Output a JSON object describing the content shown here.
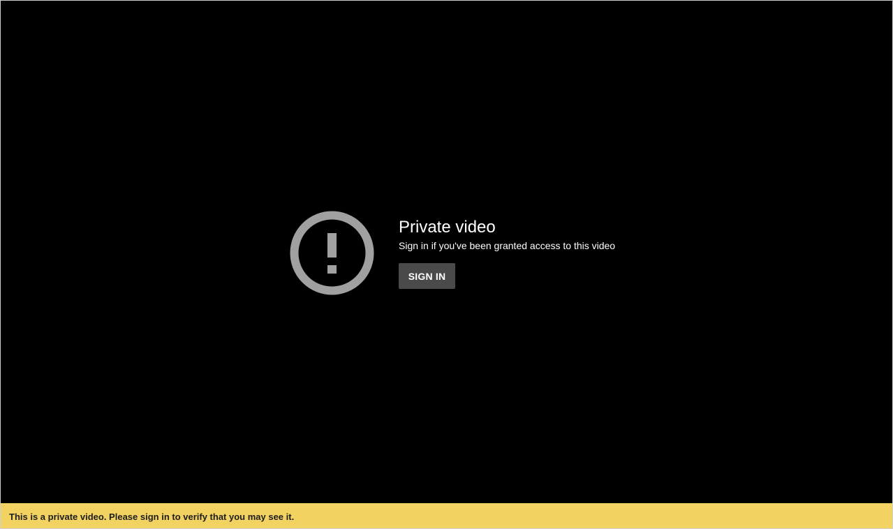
{
  "player": {
    "icon": "exclamation-circle-icon",
    "title": "Private video",
    "subtitle": "Sign in if you've been granted access to this video",
    "sign_in_label": "SIGN IN"
  },
  "notice": {
    "text": "This is a private video. Please sign in to verify that you may see it."
  },
  "colors": {
    "background": "#000000",
    "icon": "#a0a0a0",
    "button": "#4a4a4a",
    "notice_bar": "#f2d261"
  }
}
